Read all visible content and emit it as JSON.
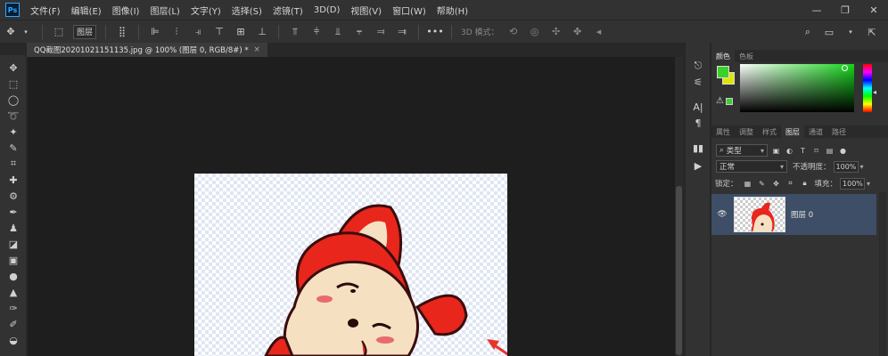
{
  "app": {
    "logo": "Ps",
    "menu": [
      "文件(F)",
      "编辑(E)",
      "图像(I)",
      "图层(L)",
      "文字(Y)",
      "选择(S)",
      "滤镜(T)",
      "3D(D)",
      "视图(V)",
      "窗口(W)",
      "帮助(H)"
    ],
    "window_controls": [
      "—",
      "❐",
      "✕"
    ]
  },
  "options": {
    "auto_select_value": "图层",
    "mode_3d_label": "3D 模式："
  },
  "document": {
    "tab_title": "QQ截图20201021151135.jpg @ 100% (图层 0, RGB/8#) *",
    "close": "×"
  },
  "color_panel": {
    "tabs": [
      "颜色",
      "色板"
    ],
    "foreground": "#3ad12a",
    "background": "#e0e400"
  },
  "layers_panel": {
    "tabs": [
      "属性",
      "调整",
      "样式",
      "图层",
      "通道",
      "路径"
    ],
    "filter_label": "类型",
    "blend_mode": "正常",
    "opacity_label": "不透明度：",
    "opacity": "100%",
    "lock_label": "锁定：",
    "fill_label": "填充：",
    "fill": "100%",
    "layers": [
      {
        "name": "图层 0"
      }
    ]
  },
  "colors": {
    "accent": "#31a8ff",
    "selected_layer": "#3d4e66",
    "character_red": "#e8261c",
    "face": "#f5e0c2",
    "arrow": "#e8352a"
  }
}
